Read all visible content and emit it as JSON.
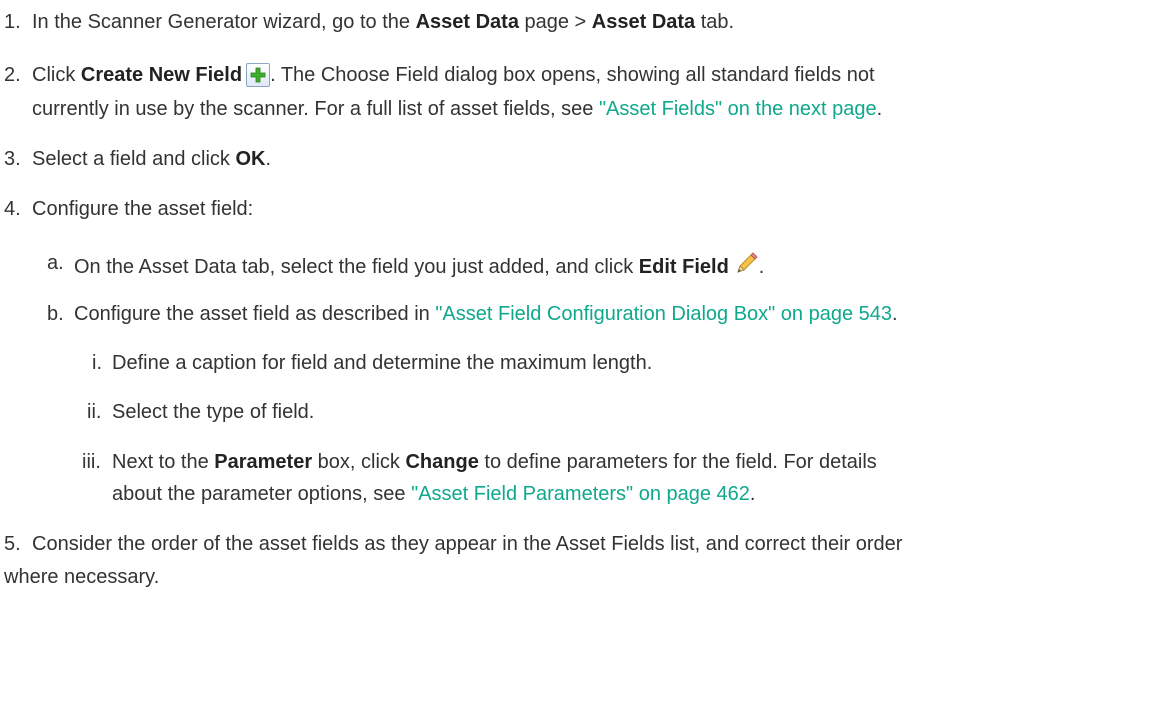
{
  "steps": [
    {
      "num": "1.",
      "text_1": "In the Scanner Generator wizard, go to the ",
      "bold_1": "Asset Data",
      "text_2": " page > ",
      "bold_2": "Asset Data",
      "text_3": " tab."
    },
    {
      "num": "2.",
      "text_1": "Click ",
      "bold_1": "Create New Field",
      "icon": "add-field-icon",
      "text_2": ". The Choose Field dialog box opens, showing all standard fields not",
      "text_3": "currently in use by the scanner. For a full list of asset fields, see ",
      "link": "\"Asset Fields\" on the next page",
      "text_4": "."
    },
    {
      "num": "3.",
      "text_1": "Select a field and click ",
      "bold_1": "OK",
      "text_2": "."
    },
    {
      "num": "4.",
      "text_1": "Configure the asset field:",
      "substeps": [
        {
          "num": "a.",
          "text_1": "On the Asset Data tab, select the field you just added, and click ",
          "bold_1": "Edit Field",
          "icon": "pencil-icon",
          "text_2": "."
        },
        {
          "num": "b.",
          "text_1": "Configure the asset field as described in ",
          "link": "\"Asset Field Configuration Dialog Box\" on page 543",
          "text_2": ".",
          "items": [
            {
              "num": "i.",
              "text_1": "Define a caption for field and determine the maximum length."
            },
            {
              "num": "ii.",
              "text_1": "Select the type of field."
            },
            {
              "num": "iii.",
              "text_1": "Next to the ",
              "bold_1": "Parameter",
              "text_2": " box, click ",
              "bold_2": "Change",
              "text_3": " to define parameters for the field. For details",
              "text_4": "about the parameter options, see ",
              "link": "\"Asset Field Parameters\" on page 462",
              "text_5": "."
            }
          ]
        }
      ]
    },
    {
      "num": "5.",
      "text_1": "Consider the order of the asset fields as they appear in the Asset Fields list, and correct their order",
      "text_2": "where necessary."
    }
  ],
  "colors": {
    "text": "#333333",
    "link": "#0fa88c"
  }
}
